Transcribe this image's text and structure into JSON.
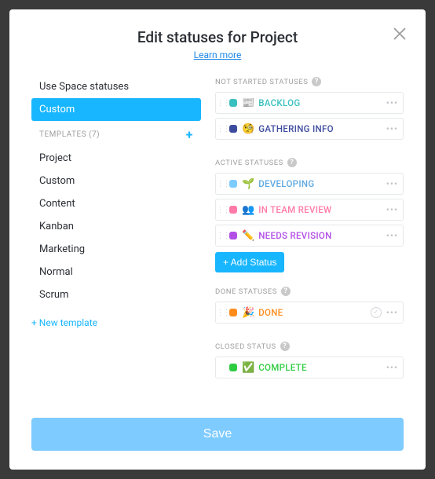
{
  "header": {
    "title": "Edit statuses for Project",
    "learn_more": "Learn more"
  },
  "sidebar": {
    "use_space": "Use Space statuses",
    "custom": "Custom",
    "templates_label": "TEMPLATES (7)",
    "templates": [
      "Project",
      "Custom",
      "Content",
      "Kanban",
      "Marketing",
      "Normal",
      "Scrum"
    ],
    "new_template": "+ New template"
  },
  "sections": {
    "not_started_label": "NOT STARTED STATUSES",
    "active_label": "ACTIVE STATUSES",
    "done_label": "DONE STATUSES",
    "closed_label": "CLOSED STATUS",
    "add_status": "+ Add Status"
  },
  "statuses": {
    "not_started": [
      {
        "color": "#3abfbf",
        "emoji": "📰",
        "label": "BACKLOG",
        "text_color": "#3abfbf"
      },
      {
        "color": "#3d4b9e",
        "emoji": "🧐",
        "label": "GATHERING INFO",
        "text_color": "#3d4b9e"
      }
    ],
    "active": [
      {
        "color": "#7ecbff",
        "emoji": "🌱",
        "label": "DEVELOPING",
        "text_color": "#5fa8e0"
      },
      {
        "color": "#ff7aa8",
        "emoji": "👥",
        "label": "IN TEAM REVIEW",
        "text_color": "#ff7aa8"
      },
      {
        "color": "#b24de6",
        "emoji": "✏️",
        "label": "NEEDS REVISION",
        "text_color": "#b24de6"
      }
    ],
    "done": [
      {
        "color": "#ff8c1a",
        "emoji": "🎉",
        "label": "DONE",
        "text_color": "#ff8c1a"
      }
    ],
    "closed": [
      {
        "color": "#2ecc40",
        "emoji": "✅",
        "label": "COMPLETE",
        "text_color": "#2ecc40"
      }
    ]
  },
  "footer": {
    "save": "Save"
  }
}
